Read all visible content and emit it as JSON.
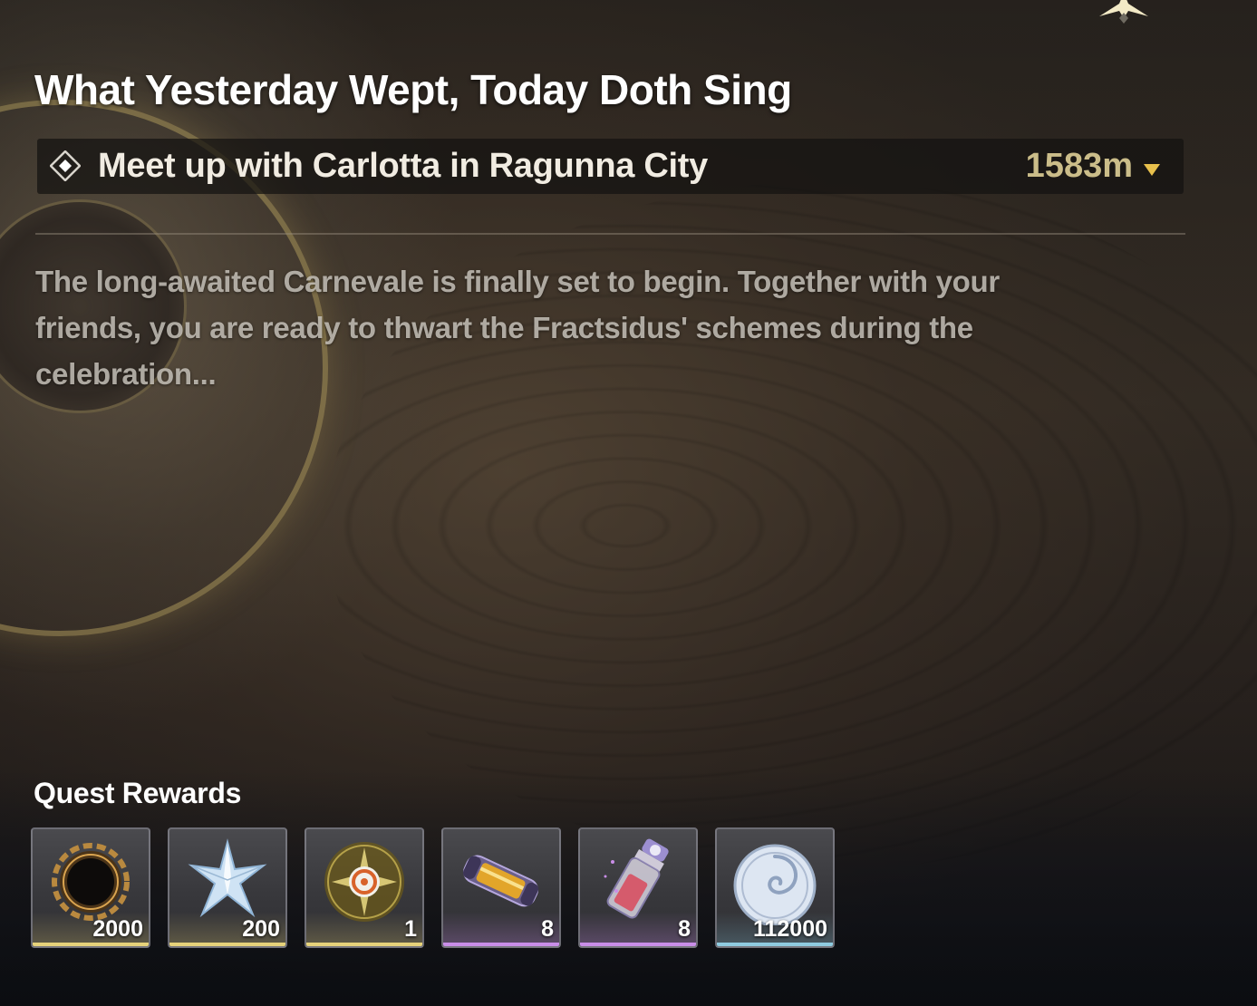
{
  "quest": {
    "title": "What Yesterday Wept, Today Doth Sing",
    "objective": {
      "text": "Meet up with Carlotta in Ragunna City",
      "distance": "1583m",
      "icon": "diamond-marker-icon"
    },
    "description": "The long-awaited Carnevale is finally set to begin. Together with your friends, you are ready to thwart the Fractsidus' schemes during the celebration..."
  },
  "rewards": {
    "title": "Quest Rewards",
    "items": [
      {
        "icon": "dark-sun-ring-icon",
        "quantity": "2000",
        "rarity_color": "#e6d27a"
      },
      {
        "icon": "star-crystal-icon",
        "quantity": "200",
        "rarity_color": "#e6d27a"
      },
      {
        "icon": "spiral-orb-icon",
        "quantity": "1",
        "rarity_color": "#e6d27a"
      },
      {
        "icon": "energy-capsule-icon",
        "quantity": "8",
        "rarity_color": "#c98ee8"
      },
      {
        "icon": "potion-vial-icon",
        "quantity": "8",
        "rarity_color": "#c98ee8"
      },
      {
        "icon": "shell-coin-icon",
        "quantity": "112000",
        "rarity_color": "#8fcbe0"
      }
    ]
  },
  "colors": {
    "distance": "#cbbd89",
    "caret": "#e8c04c",
    "gold_rarity": "#e6d27a",
    "purple_rarity": "#c98ee8",
    "blue_rarity": "#8fcbe0"
  }
}
